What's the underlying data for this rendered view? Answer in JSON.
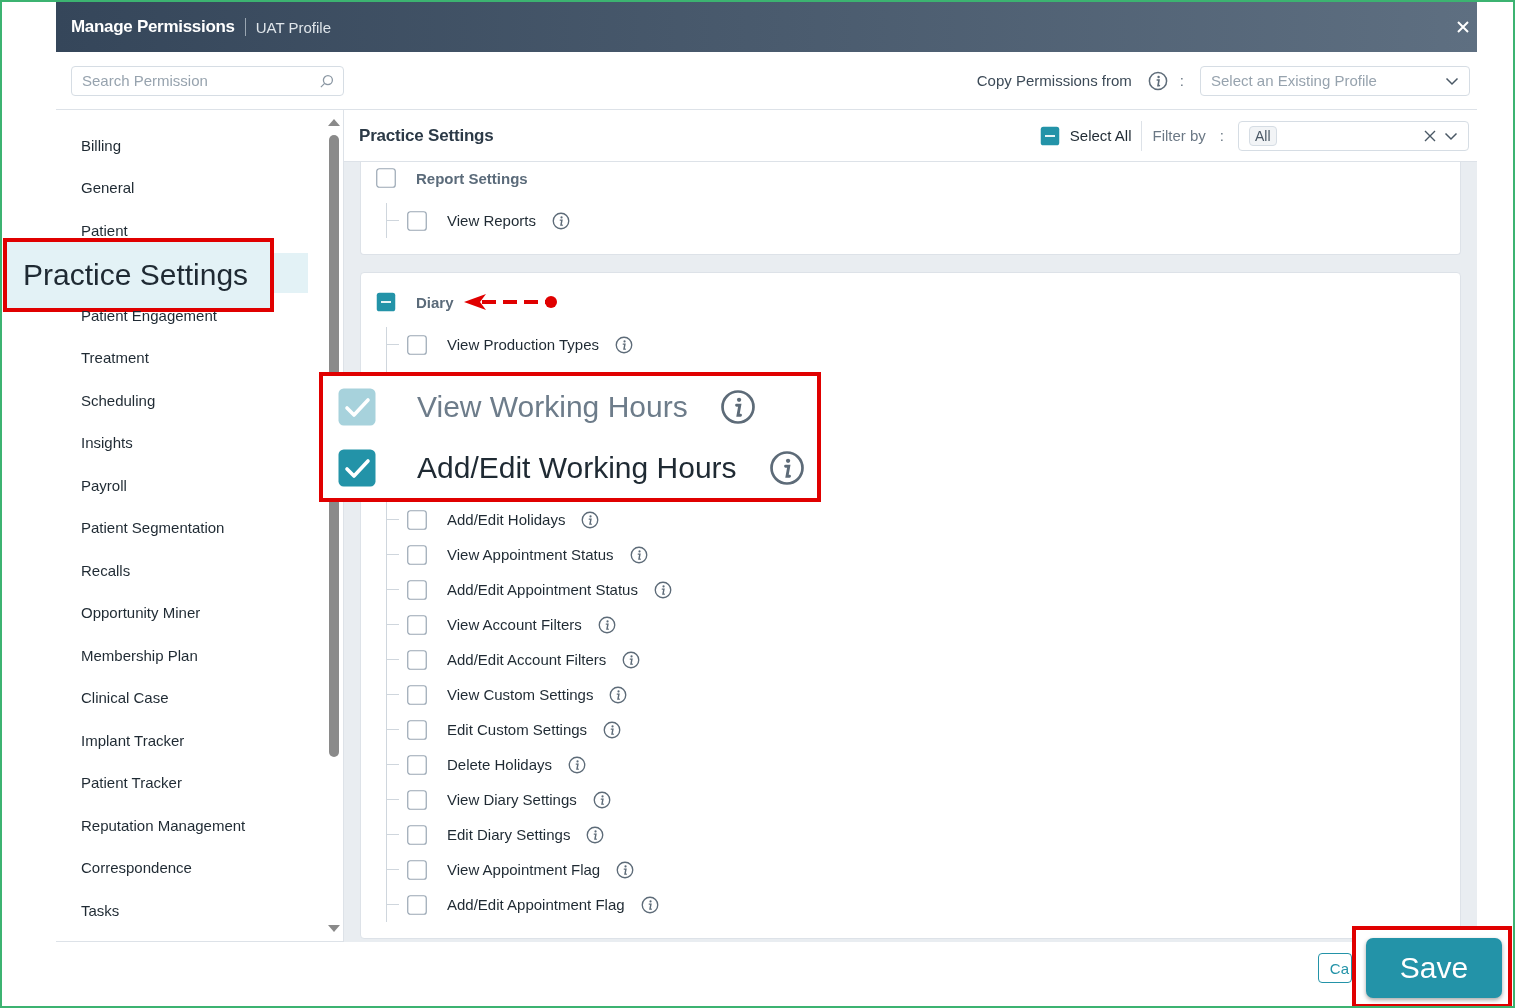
{
  "dialog": {
    "title": "Manage Permissions",
    "subtitle": "UAT Profile"
  },
  "search": {
    "placeholder": "Search Permission"
  },
  "copy": {
    "label": "Copy Permissions from",
    "separator": ":",
    "placeholder": "Select an Existing Profile"
  },
  "sidebar": {
    "items": [
      {
        "label": "Billing",
        "selected": false
      },
      {
        "label": "General",
        "selected": false
      },
      {
        "label": "Patient",
        "selected": false
      },
      {
        "label": "Practice Settings",
        "selected": true
      },
      {
        "label": "Patient Engagement",
        "selected": false
      },
      {
        "label": "Treatment",
        "selected": false
      },
      {
        "label": "Scheduling",
        "selected": false
      },
      {
        "label": "Insights",
        "selected": false
      },
      {
        "label": "Payroll",
        "selected": false
      },
      {
        "label": "Patient Segmentation",
        "selected": false
      },
      {
        "label": "Recalls",
        "selected": false
      },
      {
        "label": "Opportunity Miner",
        "selected": false
      },
      {
        "label": "Membership Plan",
        "selected": false
      },
      {
        "label": "Clinical Case",
        "selected": false
      },
      {
        "label": "Implant Tracker",
        "selected": false
      },
      {
        "label": "Patient Tracker",
        "selected": false
      },
      {
        "label": "Reputation Management",
        "selected": false
      },
      {
        "label": "Correspondence",
        "selected": false
      },
      {
        "label": "Tasks",
        "selected": false
      }
    ]
  },
  "panel": {
    "title": "Practice Settings",
    "select_all": {
      "label": "Select All",
      "checked": false,
      "indeterminate": true
    },
    "filter": {
      "label": "Filter by",
      "separator": ":",
      "chips": [
        "All"
      ]
    }
  },
  "groups": [
    {
      "label": "Report Settings",
      "checked": false,
      "indeterminate": false,
      "annotated": false,
      "children": [
        {
          "kind": "permission",
          "label": "View Reports",
          "checked": false
        }
      ]
    },
    {
      "label": "Diary",
      "checked": false,
      "indeterminate": true,
      "annotated": true,
      "children": [
        {
          "kind": "permission",
          "label": "View Production Types",
          "checked": false
        },
        {
          "kind": "callout",
          "rows": [
            {
              "label": "View Working Hours",
              "checked": true,
              "disabled": true
            },
            {
              "label": "Add/Edit Working Hours",
              "checked": true,
              "disabled": false
            }
          ]
        },
        {
          "kind": "permission",
          "label": "Add/Edit Holidays",
          "checked": false
        },
        {
          "kind": "permission",
          "label": "View Appointment Status",
          "checked": false
        },
        {
          "kind": "permission",
          "label": "Add/Edit Appointment Status",
          "checked": false
        },
        {
          "kind": "permission",
          "label": "View Account Filters",
          "checked": false
        },
        {
          "kind": "permission",
          "label": "Add/Edit Account Filters",
          "checked": false
        },
        {
          "kind": "permission",
          "label": "View Custom Settings",
          "checked": false
        },
        {
          "kind": "permission",
          "label": "Edit Custom Settings",
          "checked": false
        },
        {
          "kind": "permission",
          "label": "Delete Holidays",
          "checked": false
        },
        {
          "kind": "permission",
          "label": "View Diary Settings",
          "checked": false
        },
        {
          "kind": "permission",
          "label": "Edit Diary Settings",
          "checked": false
        },
        {
          "kind": "permission",
          "label": "View Appointment Flag",
          "checked": false
        },
        {
          "kind": "permission",
          "label": "Add/Edit Appointment Flag",
          "checked": false
        }
      ]
    }
  ],
  "footer": {
    "buttons": [
      {
        "label": "Ca",
        "kind": "outline",
        "magnified": false
      },
      {
        "label": "Save",
        "kind": "primary",
        "magnified": true
      }
    ]
  }
}
